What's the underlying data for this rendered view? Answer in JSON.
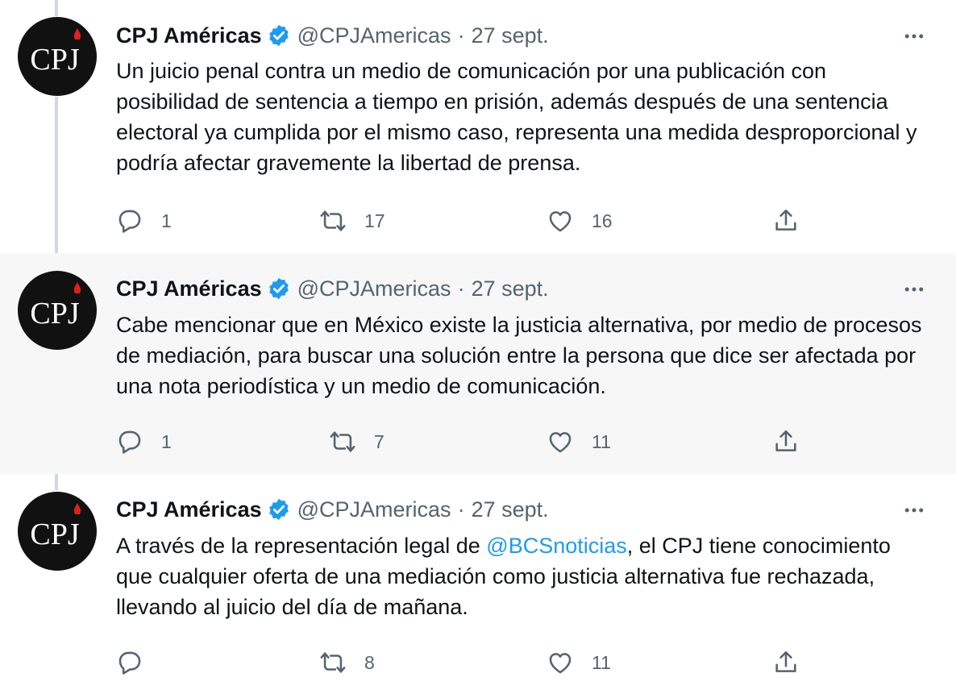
{
  "account": {
    "name": "CPJ Américas",
    "handle": "@CPJAmericas",
    "separator": "·",
    "avatar_text": "CPJ"
  },
  "tweets": [
    {
      "date": "27 sept.",
      "text": "Un juicio penal contra un medio de comunicación por una publicación con posibilidad de sentencia a tiempo en prisión, además después de una sentencia electoral ya cumplida por el mismo caso, representa una medida desproporcional y podría afectar gravemente la libertad de prensa.",
      "replies": "1",
      "retweets": "17",
      "likes": "16"
    },
    {
      "date": "27 sept.",
      "text": "Cabe mencionar que en México existe la justicia alternativa, por medio de procesos de mediación, para buscar una solución entre la persona que dice ser afectada por una nota periodística y un medio de comunicación.",
      "replies": "1",
      "retweets": "7",
      "likes": "11"
    },
    {
      "date": "27 sept.",
      "text_before": "A través de la representación legal de ",
      "mention": "@BCSnoticias",
      "text_after": ", el CPJ tiene conocimiento que cualquier oferta de una mediación como justicia alternativa fue rechazada, llevando al juicio del día de mañana.",
      "replies": "",
      "retweets": "8",
      "likes": "11"
    }
  ],
  "icons": [
    "verified-badge-icon",
    "more-options-icon",
    "reply-icon",
    "retweet-icon",
    "like-icon",
    "share-icon"
  ],
  "colors": {
    "verified": "#1d9bf0",
    "mention": "#1d9bf0",
    "highlight_bg": "#f7f7f7",
    "thread_line": "#cfd9de",
    "avatar_flame": "#e0201b"
  }
}
